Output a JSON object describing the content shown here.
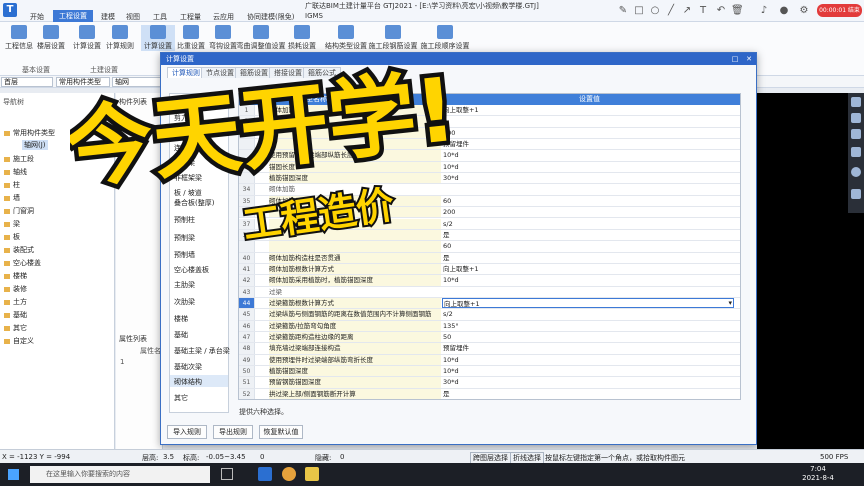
{
  "app": {
    "window_title": "广联达BIM土建计量平台 GTJ2021 - [E:\\学习资料\\亮宏\\小视频\\教学楼.GTJ]",
    "logo_letter": "T",
    "record_badge": "00:00:01 结束"
  },
  "menu": [
    "开始",
    "工程设置",
    "建模",
    "视图",
    "工具",
    "工程量",
    "云应用",
    "协同建模(限免)",
    "IGMS"
  ],
  "menu_active": "工程设置",
  "ribbon": {
    "buttons": [
      "工程信息",
      "楼层设置",
      "计算设置",
      "计算规则",
      "计算设置",
      "比重设置",
      "弯钩设置",
      "弯曲调整值设置",
      "损耗设置",
      "结构类型设置",
      "施工段钢筋设置",
      "施工段顺序设置"
    ],
    "groups": [
      "基本设置",
      "土建设置"
    ]
  },
  "bar2": {
    "floor": "首层",
    "type": "常用构件类型",
    "member": "轴网"
  },
  "left_panel": {
    "title": "导航树",
    "items": [
      "常用构件类型",
      "轴网(J)",
      "施工段",
      "轴线",
      "柱",
      "墙",
      "门窗洞",
      "梁",
      "板",
      "装配式",
      "空心楼盖",
      "楼梯",
      "装修",
      "土方",
      "基础",
      "其它",
      "自定义"
    ]
  },
  "mid_panel": {
    "title": "构件列表",
    "prop_title": "属性列表",
    "prop_col": "属性名",
    "prop_row": "1"
  },
  "dialog": {
    "title": "计算设置",
    "tabs": [
      "计算规则",
      "节点设置",
      "箍筋设置",
      "搭接设置",
      "箍筋公式"
    ],
    "categories": [
      "柱 / 墙柱",
      "剪力墙",
      "人防门框墙",
      "连梁",
      "框架梁",
      "非框架梁",
      "板 / 坡道",
      "叠合板(整厚)",
      "预制柱",
      "预制梁",
      "预制墙",
      "空心楼盖板",
      "主肋梁",
      "次肋梁",
      "楼梯",
      "基础",
      "基础主梁 / 承台梁",
      "基础次梁",
      "砌体结构",
      "其它"
    ],
    "selected_category": "砌体结构",
    "col_name": "类型名称",
    "col_value": "设置值",
    "rows": [
      {
        "n": "1",
        "name": "砌体加筋计",
        "value": "向上取整+1"
      },
      {
        "n": "2",
        "name": "砌",
        "value": "0"
      },
      {
        "n": "3",
        "name": "",
        "value": "100"
      },
      {
        "n": "",
        "name": "",
        "value": "预留埋件"
      },
      {
        "n": "",
        "name": "使用预留在圈梁端部纵筋长度",
        "value": "10*d"
      },
      {
        "n": "",
        "name": "锚固长度",
        "value": "10*d"
      },
      {
        "n": "",
        "name": "植筋锚固深度",
        "value": "30*d"
      },
      {
        "n": "34",
        "name": "砌体加筋",
        "value": "",
        "group": true
      },
      {
        "n": "35",
        "name": "砌体加筋保护层",
        "value": "60"
      },
      {
        "n": "36",
        "name": "",
        "value": "200"
      },
      {
        "n": "37",
        "name": "",
        "value": "s/2"
      },
      {
        "n": "38",
        "name": "",
        "value": "是"
      },
      {
        "n": "",
        "name": "",
        "value": "60"
      },
      {
        "n": "40",
        "name": "砌体加筋构造柱是否贯通",
        "value": "是"
      },
      {
        "n": "41",
        "name": "砌体加筋根数计算方式",
        "value": "向上取整+1"
      },
      {
        "n": "42",
        "name": "砌体加筋采用植筋时，植筋锚固深度",
        "value": "10*d"
      },
      {
        "n": "43",
        "name": "过梁",
        "value": "",
        "group": true
      },
      {
        "n": "44",
        "name": "过梁箍筋根数计算方式",
        "value": "向上取整+1",
        "selected": true
      },
      {
        "n": "45",
        "name": "过梁纵筋与侧面钢筋的距离在数值范围内不计算侧面钢筋",
        "value": "s/2"
      },
      {
        "n": "46",
        "name": "过梁箍筋/拉筋弯勾角度",
        "value": "135°"
      },
      {
        "n": "47",
        "name": "过梁箍筋距构造柱边缘的距离",
        "value": "50"
      },
      {
        "n": "48",
        "name": "填充墙过梁端部连接构造",
        "value": "预留埋件"
      },
      {
        "n": "49",
        "name": "使用预埋件时过梁端部纵筋弯折长度",
        "value": "10*d"
      },
      {
        "n": "50",
        "name": "植筋锚固深度",
        "value": "10*d"
      },
      {
        "n": "51",
        "name": "预留钢筋锚固深度",
        "value": "30*d"
      },
      {
        "n": "52",
        "name": "拱过梁上部/侧面钢筋断开计算",
        "value": "是"
      }
    ],
    "hint": "提供六种选择。",
    "footer_buttons": [
      "导入规则",
      "导出规则",
      "恢复默认值"
    ]
  },
  "status": {
    "coords": "X = -1123 Y = -994",
    "floor_height_label": "层高:",
    "floor_height": "3.5",
    "elev_label": "标高:",
    "elev": "-0.05~3.45",
    "count": "0",
    "hidden_label": "隐藏:",
    "hidden": "0",
    "span_select": "跨图层选择",
    "fold_select": "折线选择",
    "tip": "按鼠标左键指定第一个角点，或拾取构件图元",
    "fps": "500 FPS"
  },
  "taskbar": {
    "search_placeholder": "在这里输入你要搜索的内容",
    "time": "7:04",
    "date": "2021-8-4"
  },
  "overlay": {
    "headline": "今天开学!",
    "subline": "工程造价",
    "headline_color": "#ffd400",
    "outline_color": "#111111"
  }
}
